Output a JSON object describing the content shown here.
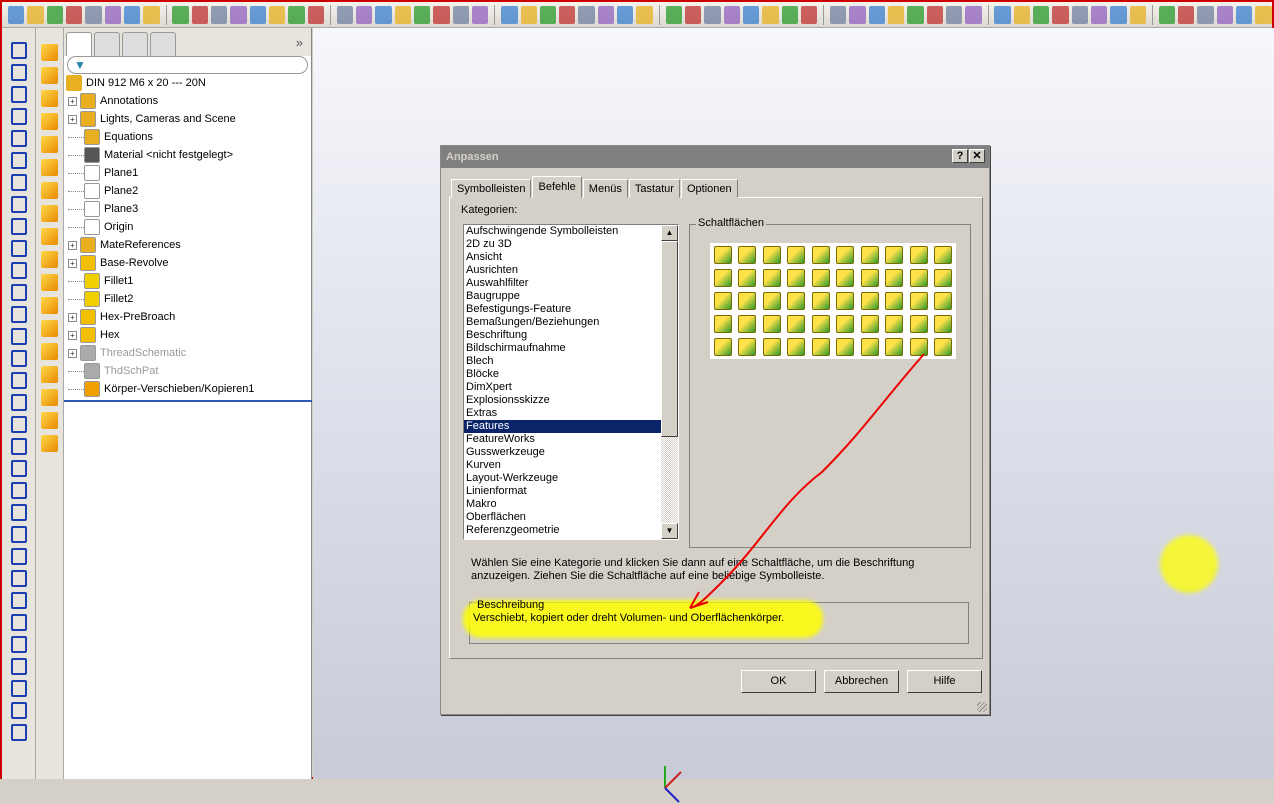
{
  "tree": {
    "root": "DIN 912 M6 x 20 --- 20N",
    "more": "»",
    "items": [
      {
        "label": "Annotations",
        "expand": true,
        "gray": false,
        "color": "#e8b020"
      },
      {
        "label": "Lights, Cameras and Scene",
        "expand": true,
        "gray": false,
        "color": "#e8b020"
      },
      {
        "label": "Equations",
        "expand": false,
        "gray": false,
        "color": "#e8b020"
      },
      {
        "label": "Material <nicht festgelegt>",
        "expand": false,
        "gray": false,
        "color": "#555555"
      },
      {
        "label": "Plane1",
        "expand": false,
        "gray": false,
        "color": "#ffffff"
      },
      {
        "label": "Plane2",
        "expand": false,
        "gray": false,
        "color": "#ffffff"
      },
      {
        "label": "Plane3",
        "expand": false,
        "gray": false,
        "color": "#ffffff"
      },
      {
        "label": "Origin",
        "expand": false,
        "gray": false,
        "color": "#ffffff"
      },
      {
        "label": "MateReferences",
        "expand": true,
        "gray": false,
        "color": "#e8b020"
      },
      {
        "label": "Base-Revolve",
        "expand": true,
        "gray": false,
        "color": "#f0c000"
      },
      {
        "label": "Fillet1",
        "expand": false,
        "gray": false,
        "color": "#f0d000"
      },
      {
        "label": "Fillet2",
        "expand": false,
        "gray": false,
        "color": "#f0d000"
      },
      {
        "label": "Hex-PreBroach",
        "expand": true,
        "gray": false,
        "color": "#f0c000"
      },
      {
        "label": "Hex",
        "expand": true,
        "gray": false,
        "color": "#f0c000"
      },
      {
        "label": "ThreadSchematic",
        "expand": true,
        "gray": true,
        "color": "#aaaaaa"
      },
      {
        "label": "ThdSchPat",
        "expand": false,
        "gray": true,
        "color": "#aaaaaa"
      },
      {
        "label": "Körper-Verschieben/Kopieren1",
        "expand": false,
        "gray": false,
        "color": "#f0a000"
      }
    ]
  },
  "dialog": {
    "title": "Anpassen",
    "help_btn": "?",
    "close_btn": "✕",
    "tabs": [
      "Symbolleisten",
      "Befehle",
      "Menüs",
      "Tastatur",
      "Optionen"
    ],
    "active_tab": 1,
    "categories_label": "Kategorien:",
    "categories": [
      "Aufschwingende Symbolleisten",
      "2D zu 3D",
      "Ansicht",
      "Ausrichten",
      "Auswahlfilter",
      "Baugruppe",
      "Befestigungs-Feature",
      "Bemaßungen/Beziehungen",
      "Beschriftung",
      "Bildschirmaufnahme",
      "Blech",
      "Blöcke",
      "DimXpert",
      "Explosionsskizze",
      "Extras",
      "Features",
      "FeatureWorks",
      "Gusswerkzeuge",
      "Kurven",
      "Layout-Werkzeuge",
      "Linienformat",
      "Makro",
      "Oberflächen",
      "Referenzgeometrie"
    ],
    "selected_category": "Features",
    "buttons_label": "Schaltflächen",
    "button_count": 50,
    "help_text": "Wählen Sie eine Kategorie und klicken Sie dann auf eine Schaltfläche, um die Beschriftung anzuzeigen. Ziehen Sie die Schaltfläche auf eine beliebige Symbolleiste.",
    "desc_label": "Beschreibung",
    "desc_value": "Verschiebt, kopiert oder dreht Volumen- und Oberflächenkörper.",
    "ok": "OK",
    "cancel": "Abbrechen",
    "help": "Hilfe"
  },
  "colors": {
    "highlight": "#ffff00",
    "annotation": "#ff0000",
    "selection": "#0a246a"
  }
}
